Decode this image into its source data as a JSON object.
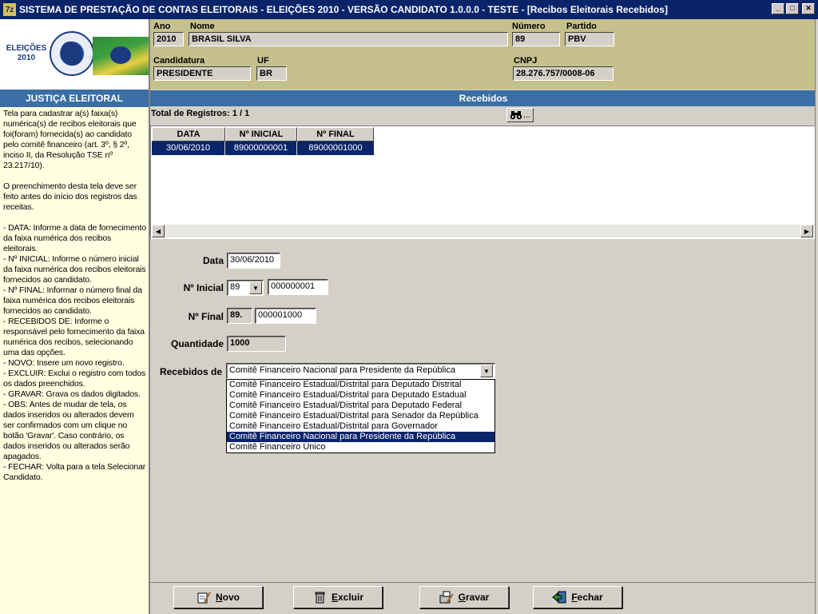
{
  "window": {
    "title": "SISTEMA DE PRESTAÇÃO DE CONTAS ELEITORAIS - ELEIÇÕES 2010 -  VERSÃO CANDIDATO 1.0.0.0 - TESTE - [Recibos Eleitorais Recebidos]",
    "icon_text": "7z",
    "minimize_icon": "_",
    "maximize_icon": "□",
    "close_icon": "✕"
  },
  "sidebar": {
    "logo_text": "ELEIÇÕES\n2010",
    "header": "JUSTIÇA ELEITORAL",
    "help_text": "Tela para cadastrar a(s) faixa(s) numérica(s) de recibos eleitorais que foi(foram) fornecida(s) ao candidato pelo comitê financeiro (art. 3º, § 2º, inciso II, da Resolução TSE nº 23.217/10).\n\nO preenchimento desta tela deve ser feito antes do início dos registros das receitas.\n\n- DATA: Informe a data de fornecimento da faixa numérica dos recibos eleitorais.\n- Nº INICIAL: Informe o número inicial da faixa numérica dos recibos eleitorais fornecidos ao candidato.\n- Nº FINAL: Informar o número final da faixa numérica dos recibos eleitorais fornecidos ao candidato.\n- RECEBIDOS DE: Informe o responsável pelo fornecimento da faixa numérica dos recibos, selecionando uma das opções.\n- NOVO: Insere um novo registro.\n- EXCLUIR: Exclui o registro com todos os dados preenchidos.\n- GRAVAR: Grava os dados digitados.\n- OBS: Antes de mudar de tela, os dados inseridos ou alterados devem ser confirmados com um clique no botão 'Gravar'. Caso contrário, os dados inseridos ou alterados serão apagados.\n- FECHAR: Volta para a tela Selecionar Candidato."
  },
  "candidate": {
    "ano_label": "Ano",
    "ano": "2010",
    "nome_label": "Nome",
    "nome": "BRASIL SILVA",
    "numero_label": "Número",
    "numero": "89",
    "partido_label": "Partido",
    "partido": "PBV",
    "candidatura_label": "Candidatura",
    "candidatura": "PRESIDENTE",
    "uf_label": "UF",
    "uf": "BR",
    "cnpj_label": "CNPJ",
    "cnpj": "28.276.757/0008-06"
  },
  "recebidos": {
    "section_title": "Recebidos",
    "total_label": "Total de Registros: 1 / 1",
    "find_icon": "binoculars-icon",
    "find_ellipsis": "...",
    "columns": [
      "DATA",
      "Nº INICIAL",
      "Nº FINAL"
    ],
    "rows": [
      [
        "30/06/2010",
        "89000000001",
        "89000001000"
      ]
    ]
  },
  "form": {
    "data_label": "Data",
    "data": "30/06/2010",
    "inicial_label": "Nº Inicial",
    "inicial_prefix": "89",
    "inicial": "000000001",
    "final_label": "Nº Final",
    "final_prefix": "89.",
    "final": "000001000",
    "quantidade_label": "Quantidade",
    "quantidade": "1000",
    "recebidos_label": "Recebidos de",
    "recebidos_selected": "Comitê Financeiro Nacional para Presidente da República",
    "recebidos_options": [
      "Comitê Financeiro Estadual/Distrital para Deputado Distrital",
      "Comitê Financeiro Estadual/Distrital para Deputado Estadual",
      "Comitê Financeiro Estadual/Distrital para Deputado Federal",
      "Comitê Financeiro Estadual/Distrital para Senador da República",
      "Comitê Financeiro Estadual/Distrital para Governador",
      "Comitê Financeiro Nacional para Presidente da República",
      "Comitê Financeiro Único"
    ]
  },
  "buttons": {
    "novo_first": "N",
    "novo_rest": "ovo",
    "excluir_first": "E",
    "excluir_rest": "xcluir",
    "gravar_first": "G",
    "gravar_rest": "ravar",
    "fechar_first": "F",
    "fechar_rest": "echar"
  },
  "colors": {
    "title_bar": "#0a246a",
    "section_bar": "#3a6ea5",
    "info_bg": "#c6c08c",
    "help_bg": "#ffffe1"
  }
}
